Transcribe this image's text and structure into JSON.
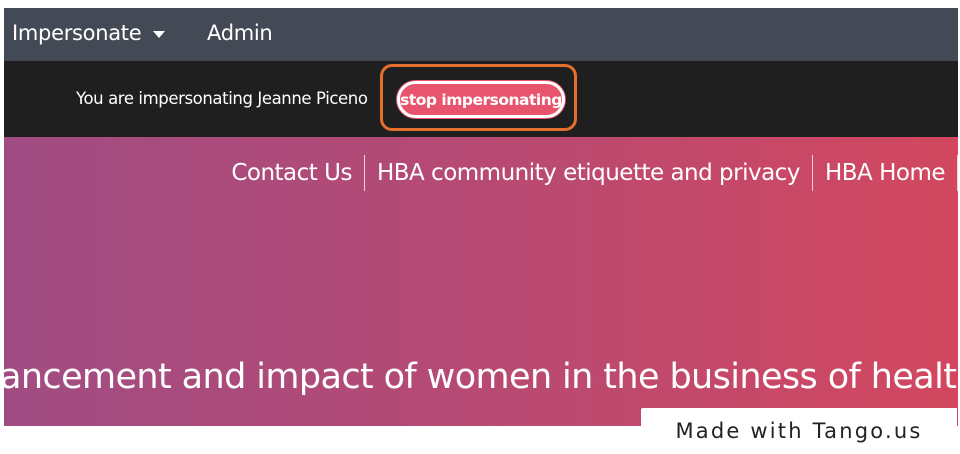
{
  "topnav": {
    "impersonate_label": "Impersonate",
    "admin_label": "Admin",
    "bg_color": "#444a55"
  },
  "impersonation_bar": {
    "status_text": "You are impersonating Jeanne Piceno",
    "stop_button_label": "stop impersonating",
    "button_color": "#e8546d",
    "highlight_color": "#e36f2f"
  },
  "hero": {
    "links": [
      "Contact Us",
      "HBA community etiquette and privacy",
      "HBA Home"
    ],
    "tagline": "ancement and impact of women in the business of healthcare",
    "gradient_start": "#a04c83",
    "gradient_end": "#d2475f"
  },
  "watermark": {
    "text": "Made with Tango.us"
  }
}
